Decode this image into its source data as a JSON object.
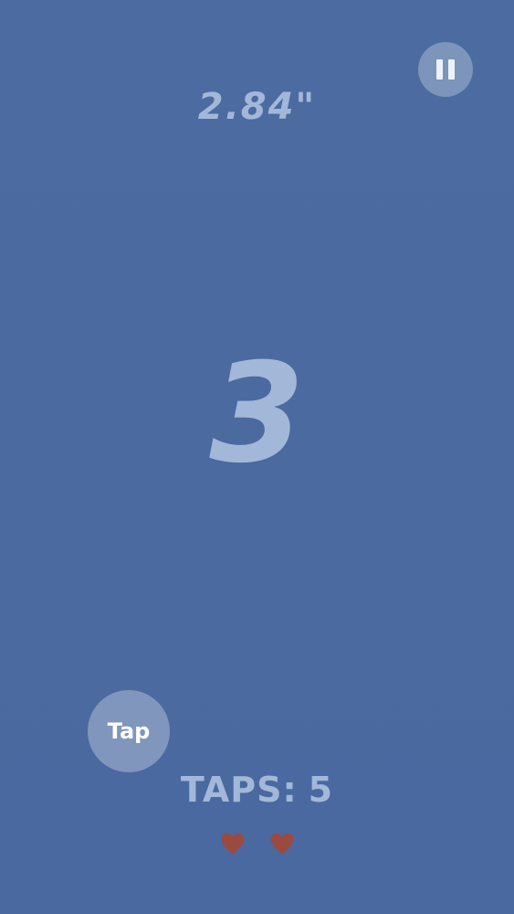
{
  "hud": {
    "timer": "2.84\"",
    "pause_icon": "pause-icon"
  },
  "game": {
    "countdown": "3"
  },
  "controls": {
    "tap_label": "Tap"
  },
  "stats": {
    "taps_label": "TAPS:",
    "taps_value": "5",
    "lives": 2,
    "heart_icon": "heart-icon",
    "heart_color": "#9c4a3f"
  },
  "colors": {
    "background": "#4a6aa0",
    "text": "#a3b8d8"
  }
}
